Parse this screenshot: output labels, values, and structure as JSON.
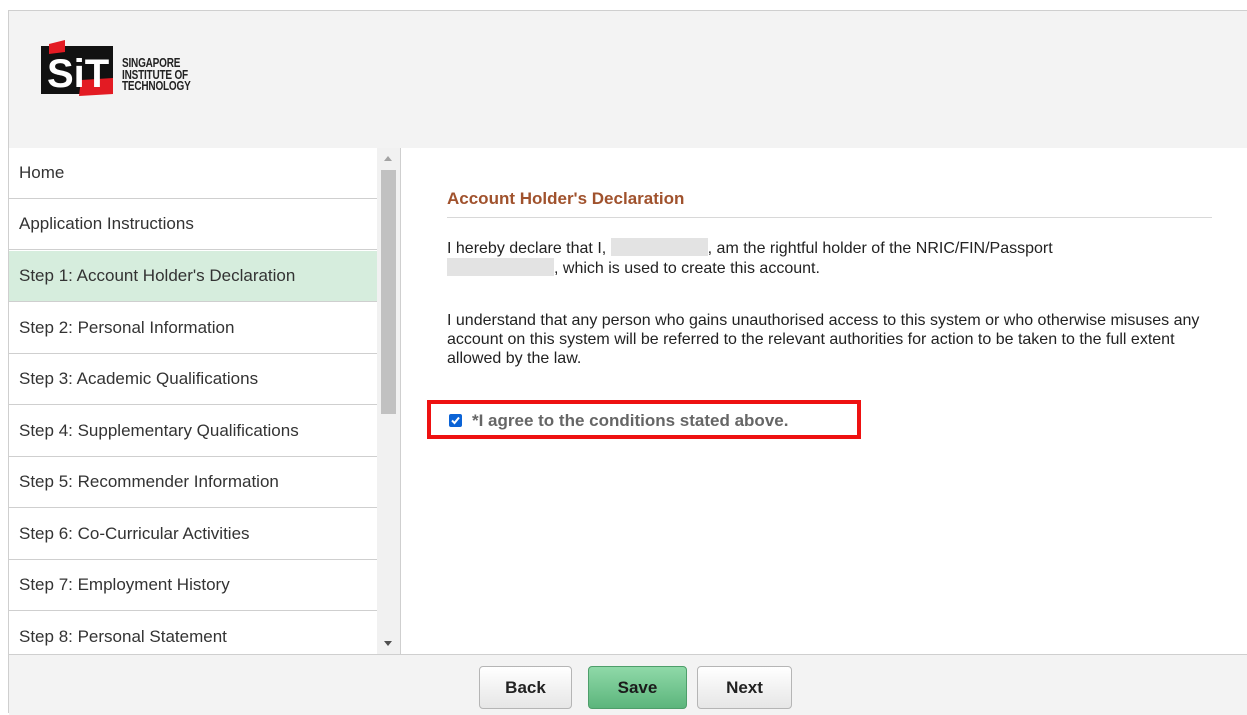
{
  "brand": {
    "logo_mark": "SiT",
    "logo_lines": [
      "SINGAPORE",
      "INSTITUTE OF",
      "TECHNOLOGY"
    ],
    "accent_red": "#e31b23"
  },
  "sidebar": {
    "items": [
      {
        "label": "Home"
      },
      {
        "label": "Application Instructions"
      },
      {
        "label": "Step 1: Account Holder's Declaration",
        "active": true
      },
      {
        "label": "Step 2: Personal Information"
      },
      {
        "label": "Step 3: Academic Qualifications"
      },
      {
        "label": "Step 4: Supplementary Qualifications"
      },
      {
        "label": "Step 5: Recommender Information"
      },
      {
        "label": "Step 6: Co-Curricular Activities"
      },
      {
        "label": "Step 7: Employment History"
      },
      {
        "label": "Step 8: Personal Statement"
      }
    ],
    "active_color": "#d6eddd"
  },
  "main": {
    "title": "Account Holder's Declaration",
    "title_color": "#a0522d",
    "declaration": {
      "part1": "I hereby declare that I,",
      "part2": ", am the rightful holder of the NRIC/FIN/Passport",
      "part3": ", which is used to create this account."
    },
    "understanding": "I understand that any person who gains unauthorised access to this system or who otherwise misuses any account on this system will be referred to the relevant authorities for action to be taken to the full extent allowed by the law.",
    "agree_label": "*I agree to the conditions stated above.",
    "agree_checked": true,
    "highlight_color": "#ee1111"
  },
  "footer": {
    "back_label": "Back",
    "save_label": "Save",
    "next_label": "Next",
    "save_color": "#6cc08b"
  }
}
